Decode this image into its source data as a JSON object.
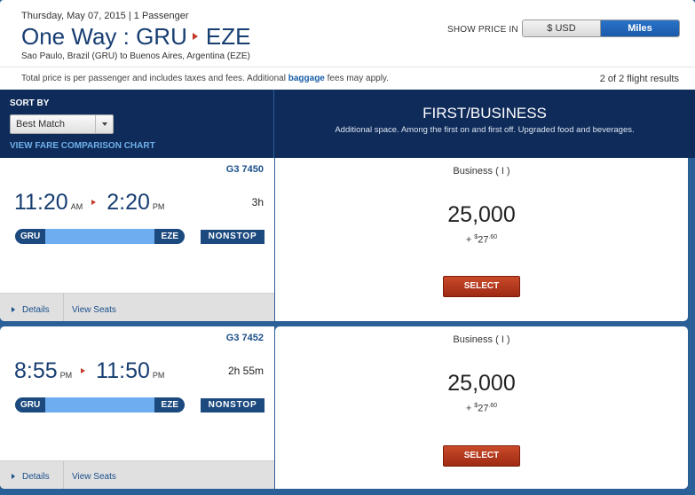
{
  "header": {
    "date_line": "Thursday, May 07, 2015 | 1 Passenger",
    "trip_type": "One Way : GRU",
    "destination": "EZE",
    "route_description": "Sao Paulo, Brazil (GRU) to Buenos Aires, Argentina (EZE)",
    "show_price_label": "SHOW PRICE IN",
    "toggle_usd": "$ USD",
    "toggle_miles": "Miles",
    "price_note_prefix": "Total price is per passenger and includes taxes and fees. Additional ",
    "price_note_link": "baggage",
    "price_note_suffix": " fees may apply.",
    "results_count": "2 of 2 flight results"
  },
  "sort": {
    "label": "SORT BY",
    "selected": "Best Match",
    "fare_chart_link": "VIEW FARE COMPARISON CHART"
  },
  "cabin": {
    "title": "FIRST/BUSINESS",
    "description": "Additional space. Among the first on and first off. Upgraded food and beverages."
  },
  "flights": [
    {
      "number": "G3 7450",
      "depart_time": "11:20",
      "depart_ampm": "AM",
      "arrive_time": "2:20",
      "arrive_ampm": "PM",
      "duration": "3h",
      "origin": "GRU",
      "destination": "EZE",
      "stops": "NONSTOP",
      "details_link": "Details",
      "seats_link": "View Seats",
      "fare_cabin": "Business ( I )",
      "miles": "25,000",
      "tax_prefix": "+ ",
      "tax_currency": "$",
      "tax_whole": "27",
      "tax_cents": ".60",
      "select_label": "SELECT"
    },
    {
      "number": "G3 7452",
      "depart_time": "8:55",
      "depart_ampm": "PM",
      "arrive_time": "11:50",
      "arrive_ampm": "PM",
      "duration": "2h 55m",
      "origin": "GRU",
      "destination": "EZE",
      "stops": "NONSTOP",
      "details_link": "Details",
      "seats_link": "View Seats",
      "fare_cabin": "Business ( I )",
      "miles": "25,000",
      "tax_prefix": "+ ",
      "tax_currency": "$",
      "tax_whole": "27",
      "tax_cents": ".60",
      "select_label": "SELECT"
    }
  ],
  "colors": {
    "navy": "#0f2b5a",
    "accent_blue": "#1b5aab",
    "route_bar": "#6eaef0",
    "select_red": "#b23a1e",
    "arrow_red": "#c0392b"
  }
}
